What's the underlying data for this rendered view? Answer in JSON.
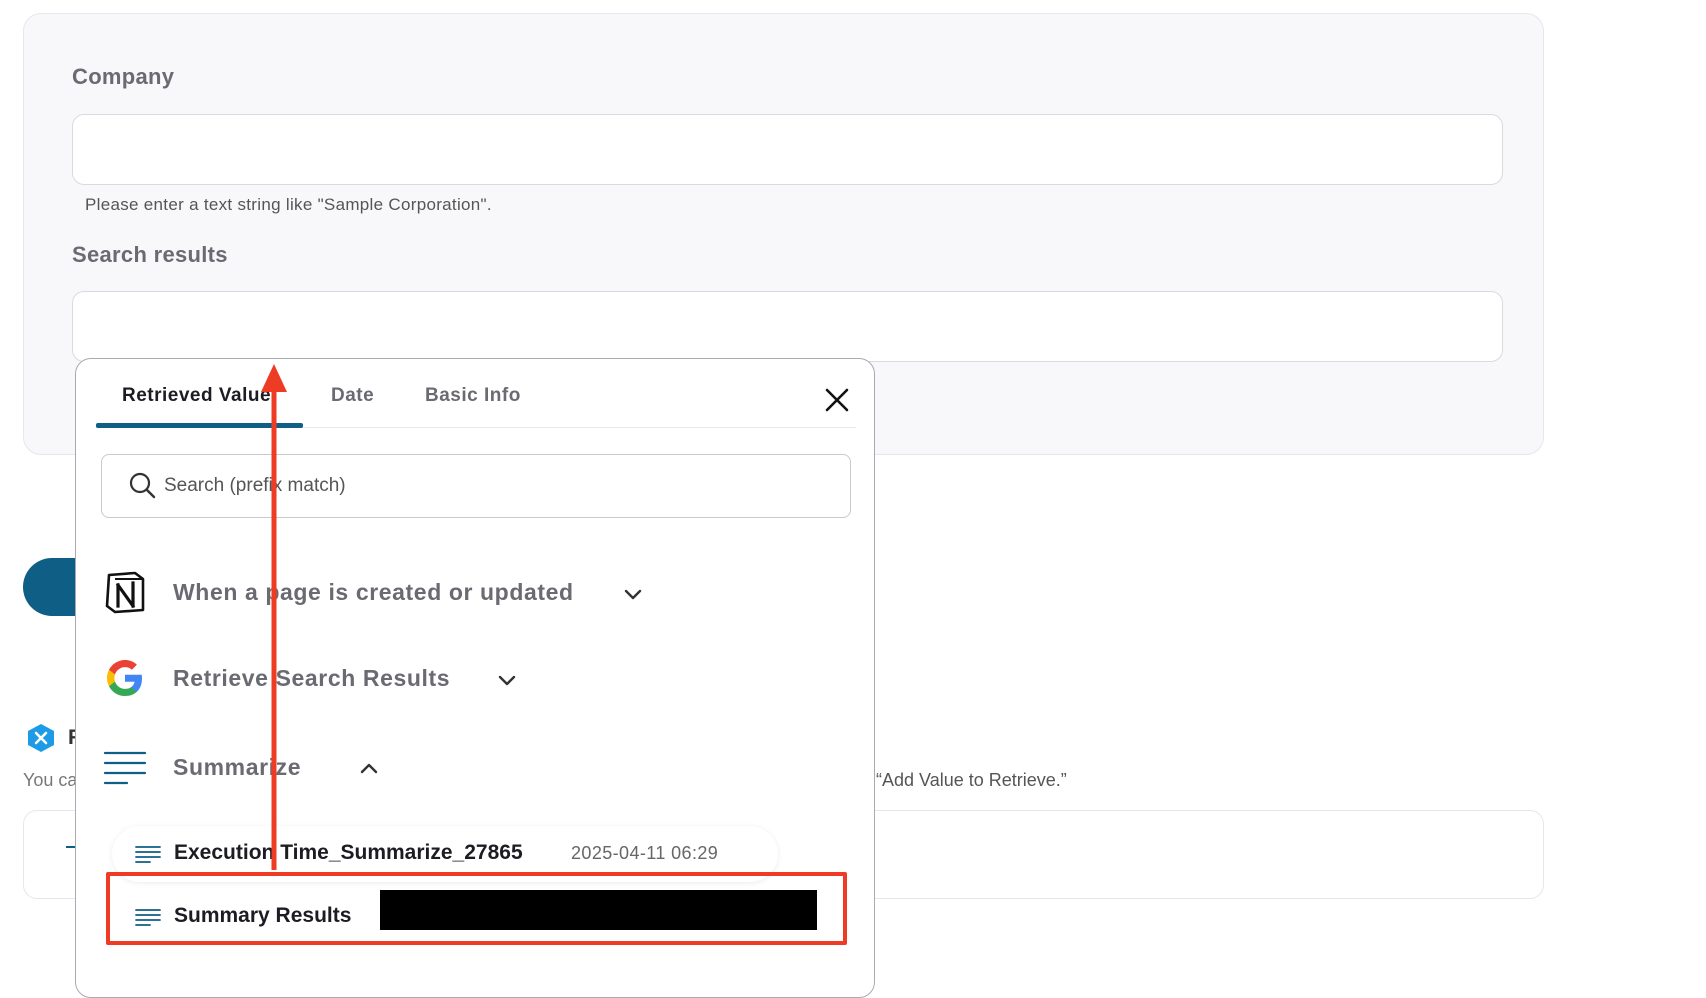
{
  "form": {
    "company_label": "Company",
    "company_value": "",
    "company_hint": "Please enter a text string like \"Sample Corporation\".",
    "search_results_label": "Search results",
    "search_results_value": ""
  },
  "background": {
    "r_fragment": "F",
    "you_can_fragment": "You ca",
    "add_value_text": "“Add Value to Retrieve.”"
  },
  "popup": {
    "tabs": [
      {
        "label": "Retrieved Value",
        "active": true
      },
      {
        "label": "Date",
        "active": false
      },
      {
        "label": "Basic Info",
        "active": false
      }
    ],
    "search_placeholder": "Search (prefix match)",
    "sections": [
      {
        "title": "When a page is created or updated",
        "icon": "notion-logo-icon",
        "expanded": false
      },
      {
        "title": "Retrieve Search Results",
        "icon": "google-logo-icon",
        "expanded": false
      },
      {
        "title": "Summarize",
        "icon": "summarize-lines-icon",
        "expanded": true
      }
    ],
    "values": [
      {
        "name": "Execution Time_Summarize_27865",
        "timestamp": "2025-04-11 06:29"
      },
      {
        "name": "Summary Results",
        "timestamp": ""
      }
    ]
  },
  "colors": {
    "accent": "#0e5e86",
    "highlight": "#ee3b24",
    "text_muted": "#6a6a72"
  }
}
